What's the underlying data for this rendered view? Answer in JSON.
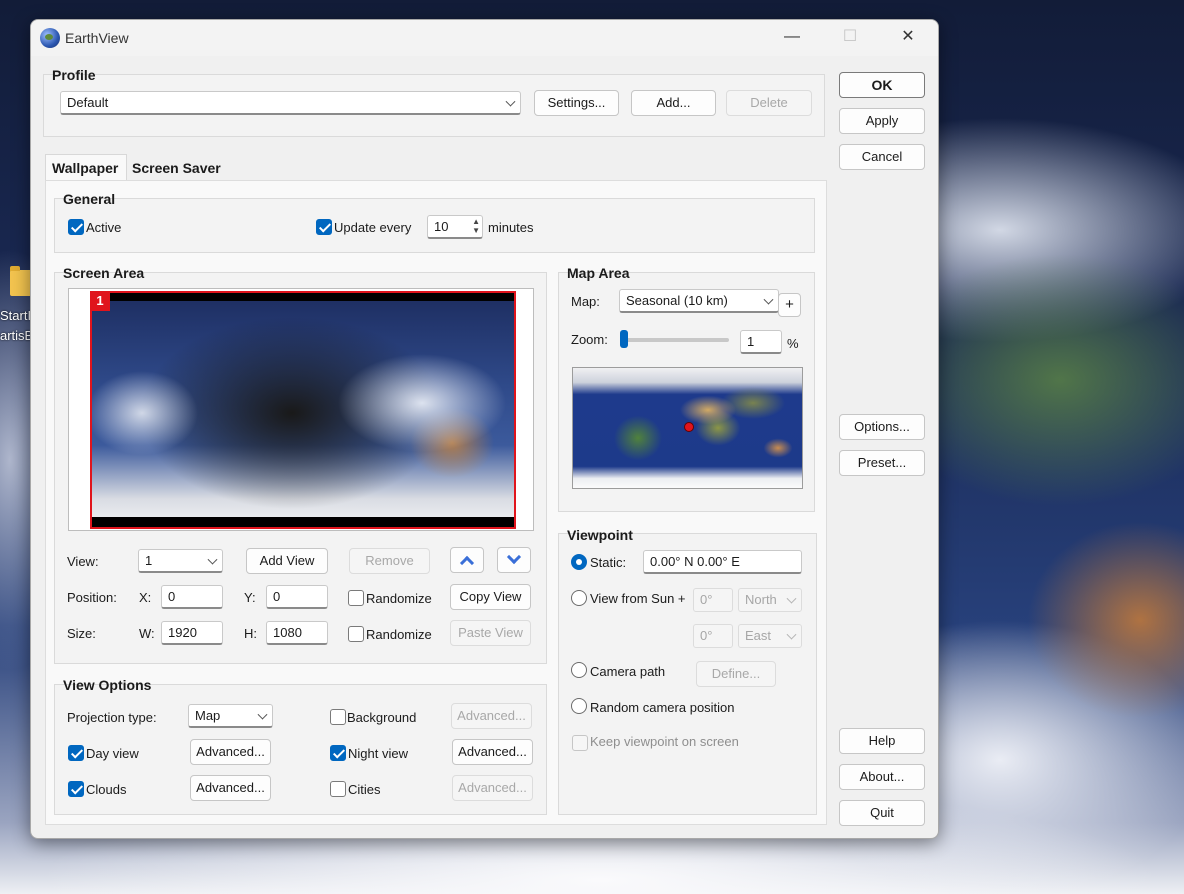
{
  "desktop": {
    "icon_line1": "StartI",
    "icon_line2": "artisB"
  },
  "window": {
    "title": "EarthView",
    "minimize": "—",
    "maximize": "☐",
    "close": "✕"
  },
  "profile": {
    "title": "Profile",
    "selected": "Default",
    "settings_label": "Settings...",
    "add_label": "Add...",
    "delete_label": "Delete"
  },
  "side_buttons": {
    "ok": "OK",
    "apply": "Apply",
    "cancel": "Cancel",
    "options": "Options...",
    "preset": "Preset...",
    "help": "Help",
    "about": "About...",
    "quit": "Quit"
  },
  "tabs": [
    {
      "label": "Wallpaper",
      "active": true
    },
    {
      "label": "Screen Saver",
      "active": false
    }
  ],
  "general": {
    "title": "General",
    "active_label": "Active",
    "active_checked": true,
    "update_label": "Update every",
    "update_checked": true,
    "update_value": "10",
    "minutes_label": "minutes"
  },
  "screen_area": {
    "title": "Screen Area",
    "badge": "1",
    "view_label": "View:",
    "view_value": "1",
    "add_view": "Add View",
    "remove": "Remove",
    "position_label": "Position:",
    "x_label": "X:",
    "x_value": "0",
    "y_label": "Y:",
    "y_value": "0",
    "randomize_label": "Randomize",
    "copy_view": "Copy View",
    "size_label": "Size:",
    "w_label": "W:",
    "w_value": "1920",
    "h_label": "H:",
    "h_value": "1080",
    "paste_view": "Paste View"
  },
  "map_area": {
    "title": "Map Area",
    "map_label": "Map:",
    "map_value": "Seasonal (10 km)",
    "plus": "+",
    "zoom_label": "Zoom:",
    "zoom_value": "1",
    "zoom_unit": "%",
    "zoom_level": 0.01
  },
  "viewpoint": {
    "title": "Viewpoint",
    "static_label": "Static:",
    "static_value": "0.00° N   0.00° E",
    "static_selected": true,
    "sun_label": "View from Sun +",
    "sun_lat": "0°",
    "sun_lat_dir": "North",
    "sun_lon": "0°",
    "sun_lon_dir": "East",
    "camera_path_label": "Camera path",
    "define_label": "Define...",
    "random_camera_label": "Random camera position",
    "keep_label": "Keep viewpoint on screen"
  },
  "view_options": {
    "title": "View Options",
    "projection_label": "Projection type:",
    "projection_value": "Map",
    "background_label": "Background",
    "advanced": "Advanced...",
    "day_view_label": "Day view",
    "night_view_label": "Night view",
    "clouds_label": "Clouds",
    "cities_label": "Cities"
  }
}
